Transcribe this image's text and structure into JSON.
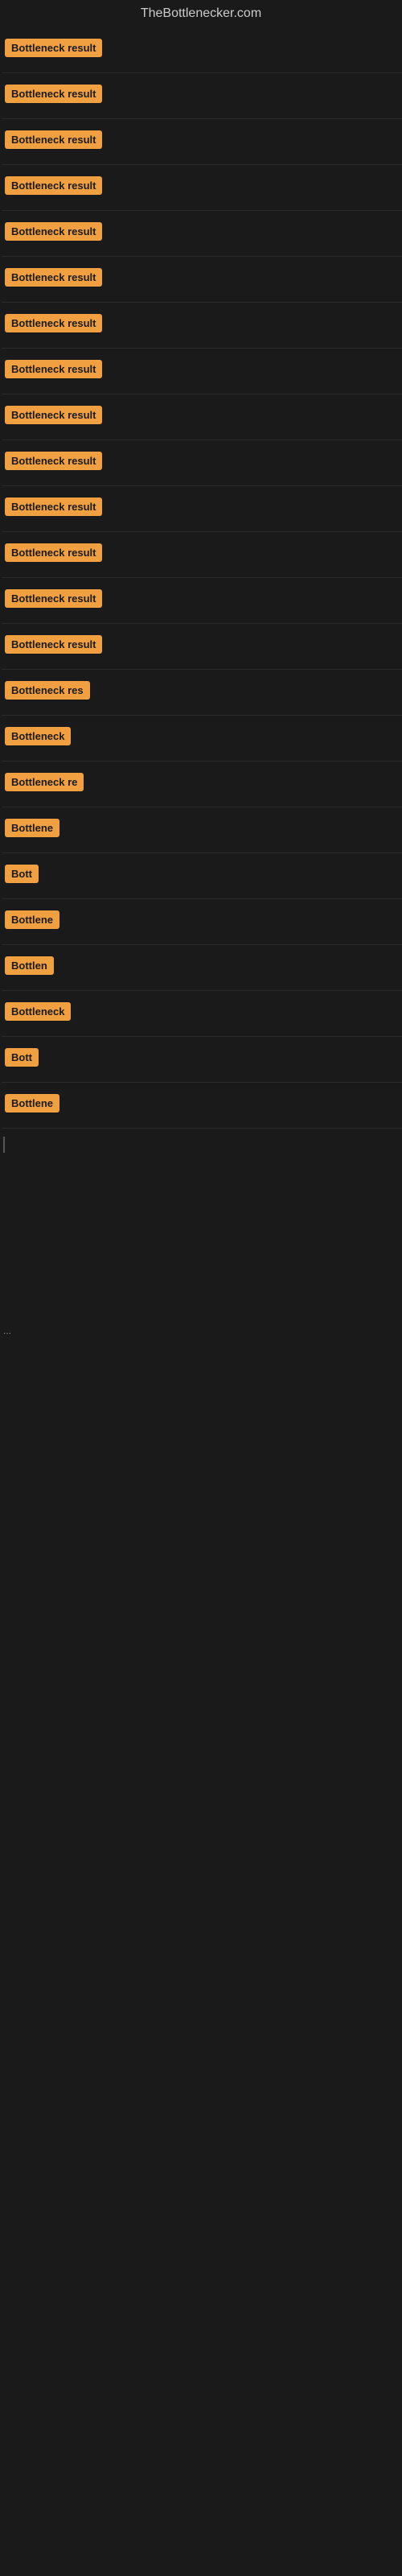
{
  "site": {
    "title": "TheBottlenecker.com"
  },
  "items": [
    {
      "label": "Bottleneck result",
      "width": 145
    },
    {
      "label": "Bottleneck result",
      "width": 145
    },
    {
      "label": "Bottleneck result",
      "width": 145
    },
    {
      "label": "Bottleneck result",
      "width": 145
    },
    {
      "label": "Bottleneck result",
      "width": 145
    },
    {
      "label": "Bottleneck result",
      "width": 145
    },
    {
      "label": "Bottleneck result",
      "width": 145
    },
    {
      "label": "Bottleneck result",
      "width": 145
    },
    {
      "label": "Bottleneck result",
      "width": 145
    },
    {
      "label": "Bottleneck result",
      "width": 145
    },
    {
      "label": "Bottleneck result",
      "width": 145
    },
    {
      "label": "Bottleneck result",
      "width": 145
    },
    {
      "label": "Bottleneck result",
      "width": 145
    },
    {
      "label": "Bottleneck result",
      "width": 145
    },
    {
      "label": "Bottleneck res",
      "width": 120
    },
    {
      "label": "Bottleneck",
      "width": 90
    },
    {
      "label": "Bottleneck re",
      "width": 105
    },
    {
      "label": "Bottlene",
      "width": 78
    },
    {
      "label": "Bott",
      "width": 48
    },
    {
      "label": "Bottlene",
      "width": 78
    },
    {
      "label": "Bottlen",
      "width": 68
    },
    {
      "label": "Bottleneck",
      "width": 90
    },
    {
      "label": "Bott",
      "width": 44
    },
    {
      "label": "Bottlene",
      "width": 75
    }
  ]
}
